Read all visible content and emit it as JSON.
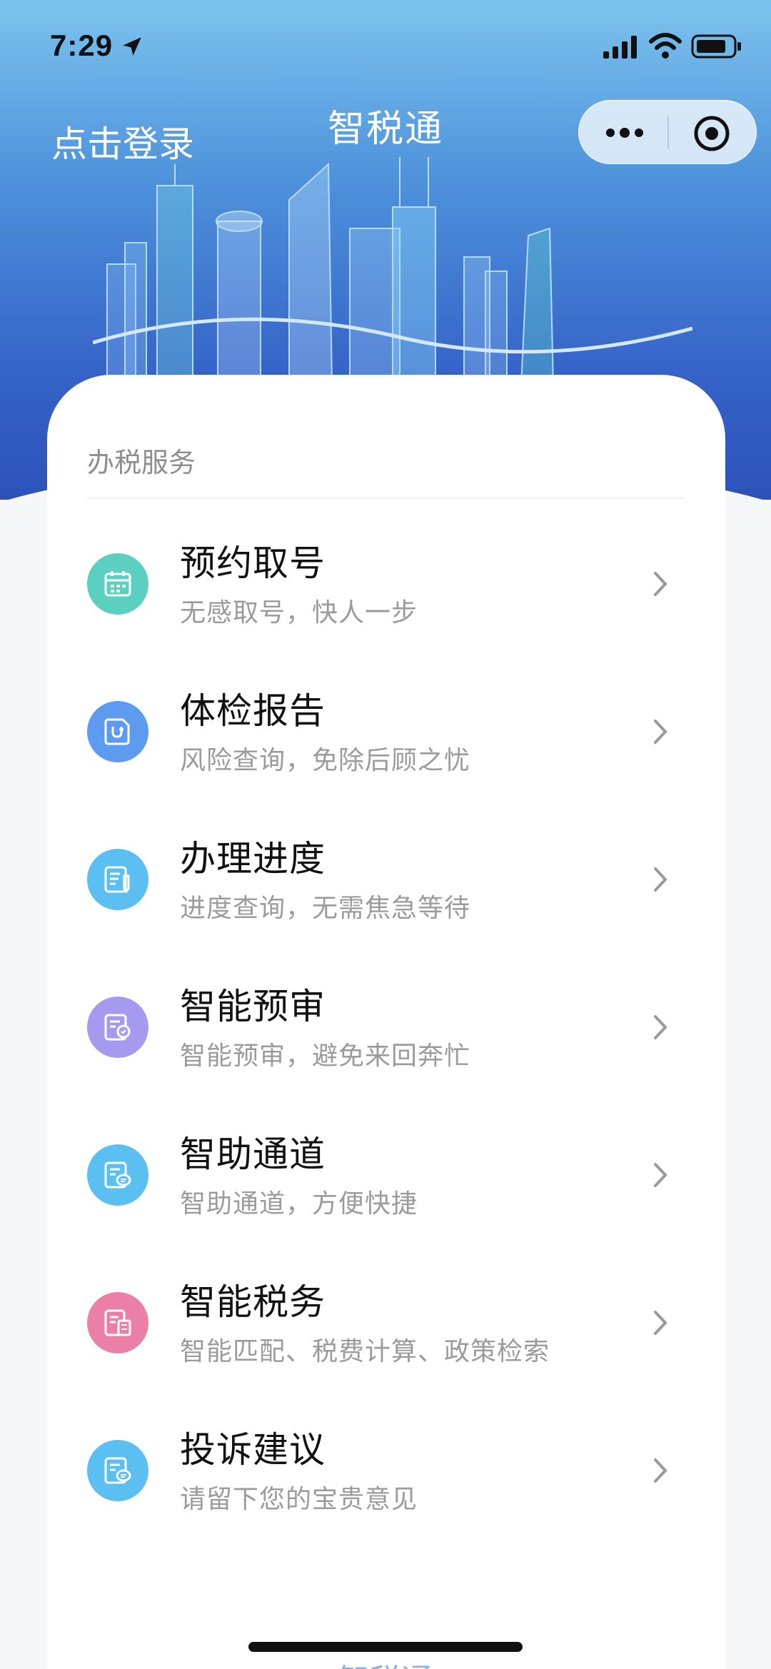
{
  "status": {
    "time": "7:29"
  },
  "header": {
    "login_label": "点击登录",
    "title": "智税通"
  },
  "section": {
    "title": "办税服务"
  },
  "services": [
    {
      "title": "预约取号",
      "subtitle": "无感取号，快人一步",
      "color": "#5cd0c0",
      "icon": "calendar-icon"
    },
    {
      "title": "体检报告",
      "subtitle": "风险查询，免除后顾之忧",
      "color": "#5c9bf0",
      "icon": "report-icon"
    },
    {
      "title": "办理进度",
      "subtitle": "进度查询，无需焦急等待",
      "color": "#5cbff2",
      "icon": "progress-doc-icon"
    },
    {
      "title": "智能预审",
      "subtitle": "智能预审，避免来回奔忙",
      "color": "#a59af0",
      "icon": "review-doc-icon"
    },
    {
      "title": "智助通道",
      "subtitle": "智助通道，方便快捷",
      "color": "#5cbff2",
      "icon": "chat-doc-icon"
    },
    {
      "title": "智能税务",
      "subtitle": "智能匹配、税费计算、政策检索",
      "color": "#ec7fa6",
      "icon": "tax-doc-icon"
    },
    {
      "title": "投诉建议",
      "subtitle": "请留下您的宝贵意见",
      "color": "#5cbff2",
      "icon": "feedback-doc-icon"
    }
  ],
  "footer": {
    "peek_text": "智税通"
  }
}
